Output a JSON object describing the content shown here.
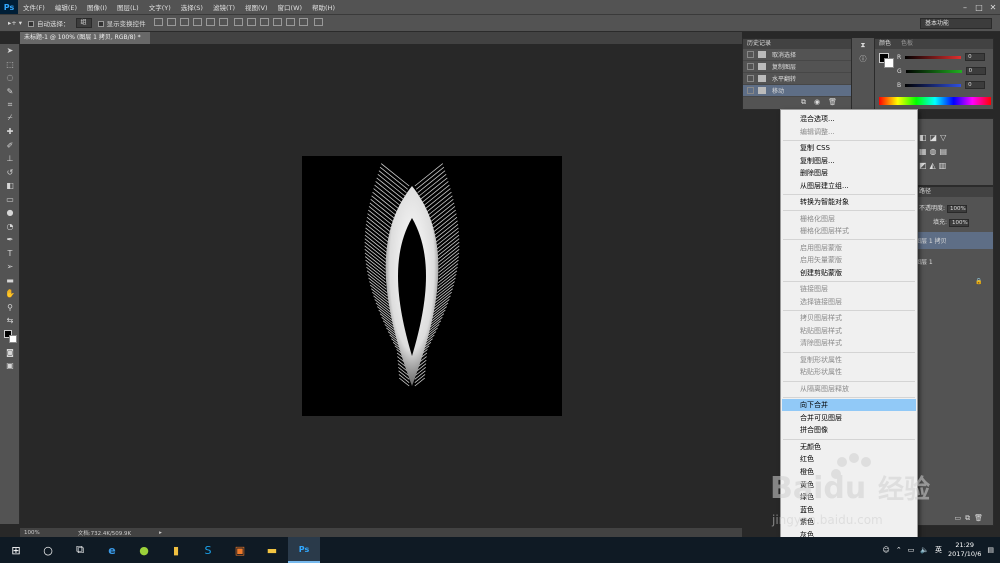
{
  "menubar": {
    "logo": "Ps",
    "items": [
      "文件(F)",
      "编辑(E)",
      "图像(I)",
      "图层(L)",
      "文字(Y)",
      "选择(S)",
      "滤镜(T)",
      "视图(V)",
      "窗口(W)",
      "帮助(H)"
    ]
  },
  "options": {
    "auto_select_label": "自动选择：",
    "auto_select_value": "组",
    "show_transform_label": "显示变换控件",
    "workspace": "基本功能"
  },
  "document": {
    "tab_title": "未标题-1 @ 100% (图层 1 拷贝, RGB/8) *",
    "zoom": "100%",
    "doc_info": "文档:732.4K/509.9K"
  },
  "history": {
    "title": "历史记录",
    "items": [
      {
        "label": "取消选择"
      },
      {
        "label": "复制图层"
      },
      {
        "label": "水平翻转"
      },
      {
        "label": "移动"
      }
    ]
  },
  "color_panel": {
    "tabs": [
      "颜色",
      "色板"
    ],
    "channels": [
      {
        "label": "R",
        "value": "0",
        "color": "#e03030"
      },
      {
        "label": "G",
        "value": "0",
        "color": "#20b020"
      },
      {
        "label": "B",
        "value": "0",
        "color": "#3050e0"
      }
    ]
  },
  "layers_panel": {
    "tab": "路径",
    "opacity_label": "不透明度:",
    "opacity_value": "100%",
    "fill_label": "填充:",
    "fill_value": "100%",
    "layers": [
      {
        "name": "图层 1 拷贝"
      },
      {
        "name": "图层 1"
      }
    ]
  },
  "context_menu": {
    "items": [
      {
        "label": "混合选项...",
        "enabled": true
      },
      {
        "label": "编辑调整...",
        "enabled": false
      },
      {
        "label": "复制 CSS",
        "enabled": true
      },
      {
        "label": "复制图层...",
        "enabled": true
      },
      {
        "label": "删除图层",
        "enabled": true
      },
      {
        "label": "从图层建立组...",
        "enabled": true
      },
      {
        "label": "转换为智能对象",
        "enabled": true
      },
      {
        "label": "栅格化图层",
        "enabled": false
      },
      {
        "label": "栅格化图层样式",
        "enabled": false
      },
      {
        "label": "启用图层蒙版",
        "enabled": false
      },
      {
        "label": "启用矢量蒙版",
        "enabled": false
      },
      {
        "label": "创建剪贴蒙版",
        "enabled": true
      },
      {
        "label": "链接图层",
        "enabled": false
      },
      {
        "label": "选择链接图层",
        "enabled": false
      },
      {
        "label": "拷贝图层样式",
        "enabled": false
      },
      {
        "label": "粘贴图层样式",
        "enabled": false
      },
      {
        "label": "清除图层样式",
        "enabled": false
      },
      {
        "label": "复制形状属性",
        "enabled": false
      },
      {
        "label": "粘贴形状属性",
        "enabled": false
      },
      {
        "label": "从隔离图层释放",
        "enabled": false
      },
      {
        "label": "向下合并",
        "enabled": true,
        "highlighted": true
      },
      {
        "label": "合并可见图层",
        "enabled": true
      },
      {
        "label": "拼合图像",
        "enabled": true
      },
      {
        "label": "无颜色",
        "enabled": true
      },
      {
        "label": "红色",
        "enabled": true
      },
      {
        "label": "橙色",
        "enabled": true
      },
      {
        "label": "黄色",
        "enabled": true
      },
      {
        "label": "绿色",
        "enabled": true
      },
      {
        "label": "蓝色",
        "enabled": true
      },
      {
        "label": "紫色",
        "enabled": true
      },
      {
        "label": "灰色",
        "enabled": true
      }
    ]
  },
  "taskbar": {
    "ime": "英",
    "time": "21:29",
    "date": "2017/10/6"
  },
  "watermark": {
    "brand": "Baidu",
    "brand_cn": "经验",
    "url": "jingyan.baidu.com"
  }
}
